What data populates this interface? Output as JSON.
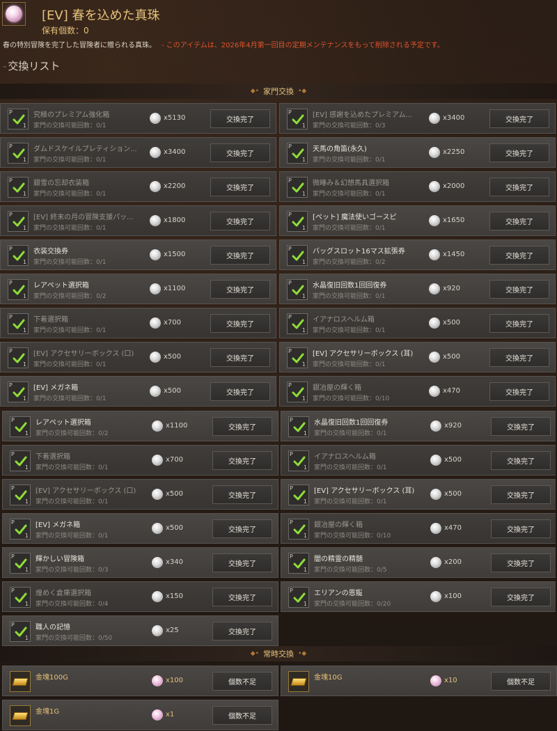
{
  "header": {
    "title": "[EV] 春を込めた真珠",
    "owned": "保有個数：0",
    "desc": "春の特別冒険を完了した冒険者に贈られる真珠。",
    "notice": "- このアイテムは、2026年4月第一回目の定期メンテナンスをもって削除される予定です。",
    "list_title": "交換リスト"
  },
  "sections": {
    "family": "家門交換",
    "regular": "常時交換"
  },
  "family_rows": [
    {
      "name": "究極のプレミアム強化箱",
      "count": "家門の交換可能回数：0/1",
      "cost": "x5130",
      "btn": "交換完了",
      "dim": true
    },
    {
      "name": "[EV] 感謝を込めたプレミアム...",
      "count": "家門の交換可能回数：0/3",
      "cost": "x3400",
      "btn": "交換完了",
      "dim": true
    },
    {
      "name": "ダムドスケイルプレティション...",
      "count": "家門の交換可能回数：0/1",
      "cost": "x3400",
      "btn": "交換完了",
      "dim": true
    },
    {
      "name": "天馬の角笛(永久)",
      "count": "家門の交換可能回数：0/1",
      "cost": "x2250",
      "btn": "交換完了",
      "dim": false
    },
    {
      "name": "銀雪の忘却衣装箱",
      "count": "家門の交換可能回数：0/1",
      "cost": "x2200",
      "btn": "交換完了",
      "dim": true
    },
    {
      "name": "微睡み＆幻想馬具選択箱",
      "count": "家門の交換可能回数：0/1",
      "cost": "x2000",
      "btn": "交換完了",
      "dim": true
    },
    {
      "name": "[EV] 終末の月の冒険支援パッ...",
      "count": "家門の交換可能回数：0/1",
      "cost": "x1800",
      "btn": "交換完了",
      "dim": true
    },
    {
      "name": "[ペット] 魔法使いゴースピ",
      "count": "家門の交換可能回数：0/1",
      "cost": "x1650",
      "btn": "交換完了",
      "dim": false
    },
    {
      "name": "衣装交換券",
      "count": "家門の交換可能回数：0/1",
      "cost": "x1500",
      "btn": "交換完了",
      "dim": false
    },
    {
      "name": "バッグスロット16マス拡張券",
      "count": "家門の交換可能回数：0/2",
      "cost": "x1450",
      "btn": "交換完了",
      "dim": false
    },
    {
      "name": "レアペット選択箱",
      "count": "家門の交換可能回数：0/2",
      "cost": "x1100",
      "btn": "交換完了",
      "dim": false
    },
    {
      "name": "水晶復旧回数1回回復券",
      "count": "家門の交換可能回数：0/1",
      "cost": "x920",
      "btn": "交換完了",
      "dim": false
    },
    {
      "name": "下着選択箱",
      "count": "家門の交換可能回数：0/1",
      "cost": "x700",
      "btn": "交換完了",
      "dim": true
    },
    {
      "name": "イアナロスヘルム箱",
      "count": "家門の交換可能回数：0/1",
      "cost": "x500",
      "btn": "交換完了",
      "dim": true
    },
    {
      "name": "[EV] アクセサリーボックス (口)",
      "count": "家門の交換可能回数：0/1",
      "cost": "x500",
      "btn": "交換完了",
      "dim": true
    },
    {
      "name": "[EV] アクセサリーボックス (耳)",
      "count": "家門の交換可能回数：0/1",
      "cost": "x500",
      "btn": "交換完了",
      "dim": false
    },
    {
      "name": "[EV] メガネ箱",
      "count": "家門の交換可能回数：0/1",
      "cost": "x500",
      "btn": "交換完了",
      "dim": false
    },
    {
      "name": "銀冶屋の輝く箱",
      "count": "家門の交換可能回数：0/10",
      "cost": "x470",
      "btn": "交換完了",
      "dim": true
    },
    {
      "name": "レアペット選択箱",
      "count": "家門の交換可能回数：0/2",
      "cost": "x1100",
      "btn": "交換完了",
      "dim": false
    },
    {
      "name": "水晶復旧回数1回回復券",
      "count": "家門の交換可能回数：0/1",
      "cost": "x920",
      "btn": "交換完了",
      "dim": false
    },
    {
      "name": "下着選択箱",
      "count": "家門の交換可能回数：0/1",
      "cost": "x700",
      "btn": "交換完了",
      "dim": true
    },
    {
      "name": "イアナロスヘルム箱",
      "count": "家門の交換可能回数：0/1",
      "cost": "x500",
      "btn": "交換完了",
      "dim": true
    },
    {
      "name": "[EV] アクセサリーボックス (口)",
      "count": "家門の交換可能回数：0/1",
      "cost": "x500",
      "btn": "交換完了",
      "dim": true
    },
    {
      "name": "[EV] アクセサリーボックス (耳)",
      "count": "家門の交換可能回数：0/1",
      "cost": "x500",
      "btn": "交換完了",
      "dim": false
    },
    {
      "name": "[EV] メガネ箱",
      "count": "家門の交換可能回数：0/1",
      "cost": "x500",
      "btn": "交換完了",
      "dim": false
    },
    {
      "name": "銀冶屋の輝く箱",
      "count": "家門の交換可能回数：0/10",
      "cost": "x470",
      "btn": "交換完了",
      "dim": true
    },
    {
      "name": "輝かしい冒険箱",
      "count": "家門の交換可能回数：0/3",
      "cost": "x340",
      "btn": "交換完了",
      "dim": false
    },
    {
      "name": "闇の精霊の精髄",
      "count": "家門の交換可能回数：0/5",
      "cost": "x200",
      "btn": "交換完了",
      "dim": false
    },
    {
      "name": "煌めく倉庫選択箱",
      "count": "家門の交換可能回数：0/4",
      "cost": "x150",
      "btn": "交換完了",
      "dim": true
    },
    {
      "name": "エリアンの恩寵",
      "count": "家門の交換可能回数：0/20",
      "cost": "x100",
      "btn": "交換完了",
      "dim": false
    },
    {
      "name": "職人の記憶",
      "count": "家門の交換可能回数：0/50",
      "cost": "x25",
      "btn": "交換完了",
      "dim": false
    }
  ],
  "regular_rows": [
    {
      "name": "金塊100G",
      "cost": "x100",
      "btn": "個数不足"
    },
    {
      "name": "金塊10G",
      "cost": "x10",
      "btn": "個数不足"
    },
    {
      "name": "金塊1G",
      "cost": "x1",
      "btn": "個数不足"
    }
  ],
  "slot_badge": "P",
  "slot_count": "1"
}
